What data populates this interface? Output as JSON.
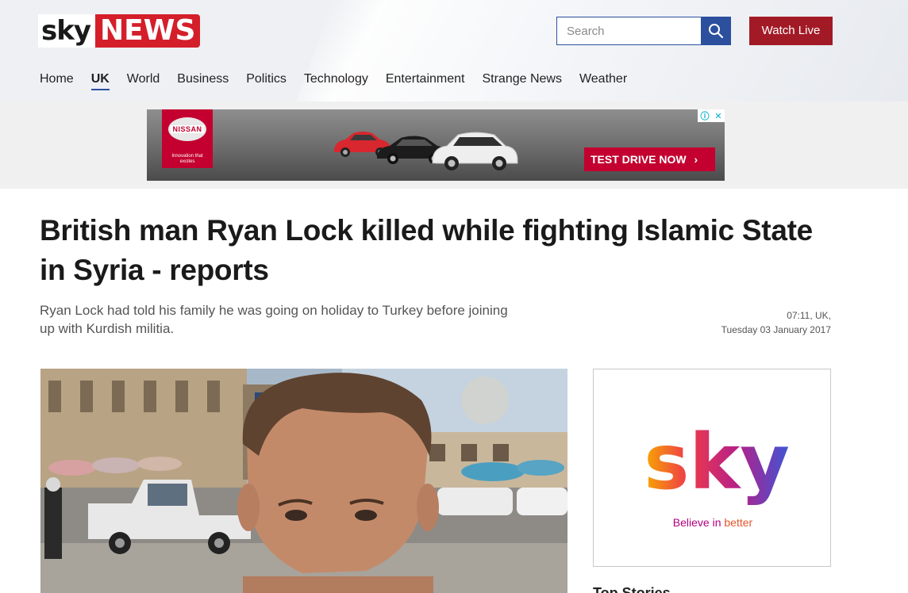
{
  "header": {
    "logo_sky": "sky",
    "logo_news": "NEWS",
    "search_placeholder": "Search",
    "watch_live": "Watch Live"
  },
  "nav": {
    "items": [
      {
        "label": "Home"
      },
      {
        "label": "UK"
      },
      {
        "label": "World"
      },
      {
        "label": "Business"
      },
      {
        "label": "Politics"
      },
      {
        "label": "Technology"
      },
      {
        "label": "Entertainment"
      },
      {
        "label": "Strange News"
      },
      {
        "label": "Weather"
      }
    ]
  },
  "ad_banner": {
    "brand": "NISSAN",
    "brand_tagline": "Innovation that excites",
    "cta": "TEST DRIVE NOW",
    "cta_arrow": "›"
  },
  "article": {
    "headline": "British man Ryan Lock killed while fighting Islamic State in Syria - reports",
    "standfirst": "Ryan Lock had told his family he was going on holiday to Turkey before joining up with Kurdish militia.",
    "time": "07:11, UK,",
    "date": "Tuesday 03 January 2017"
  },
  "side_ad": {
    "wordmark": "sky",
    "tagline_part1": "Believe in ",
    "tagline_part2": "better"
  },
  "sidebar": {
    "top_stories": "Top Stories"
  }
}
